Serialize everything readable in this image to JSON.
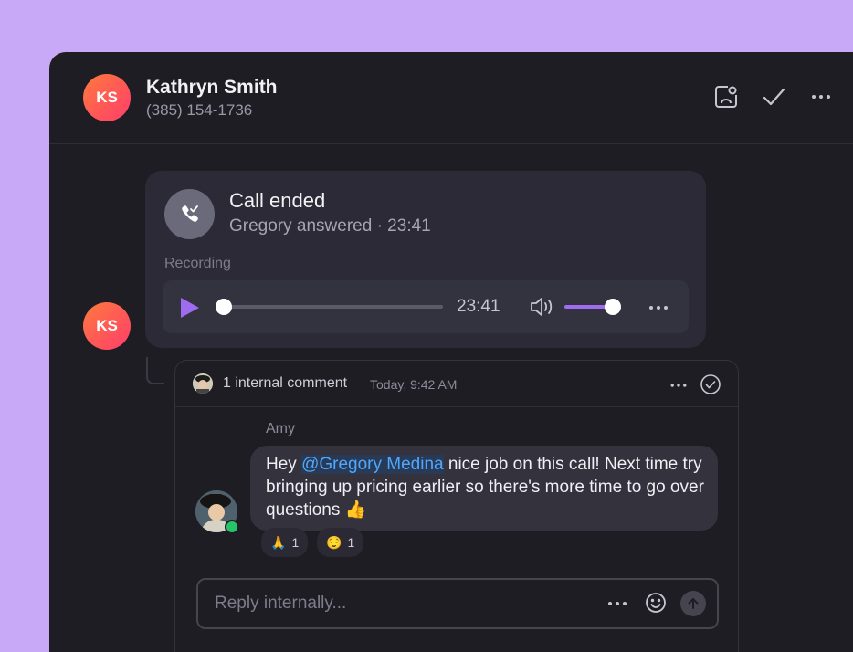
{
  "contact": {
    "initials": "KS",
    "name": "Kathryn Smith",
    "phone": "(385) 154-1736"
  },
  "header_icons": [
    "contact-card-icon",
    "check-icon",
    "more-icon"
  ],
  "call": {
    "title": "Call ended",
    "subtitle": "Gregory answered · 23:41",
    "recording_label": "Recording",
    "duration": "23:41",
    "playback_progress": 0.0,
    "volume_level": 0.9
  },
  "comments": {
    "count_label": "1 internal comment",
    "time": "Today, 9:42 AM",
    "author": "Amy",
    "message_before": "Hey ",
    "mention": "@Gregory Medina",
    "message_after": " nice job on this call! Next time try bringing up pricing earlier so there's more time to go over questions 👍",
    "reactions": [
      {
        "emoji": "🙏",
        "count": "1"
      },
      {
        "emoji": "😌",
        "count": "1"
      }
    ]
  },
  "reply": {
    "placeholder": "Reply internally..."
  },
  "colors": {
    "background": "#c8a9f7",
    "panel": "#1e1d24",
    "accent": "#9f6bf0",
    "mention": "#4fa8ff",
    "online": "#27c36a"
  }
}
